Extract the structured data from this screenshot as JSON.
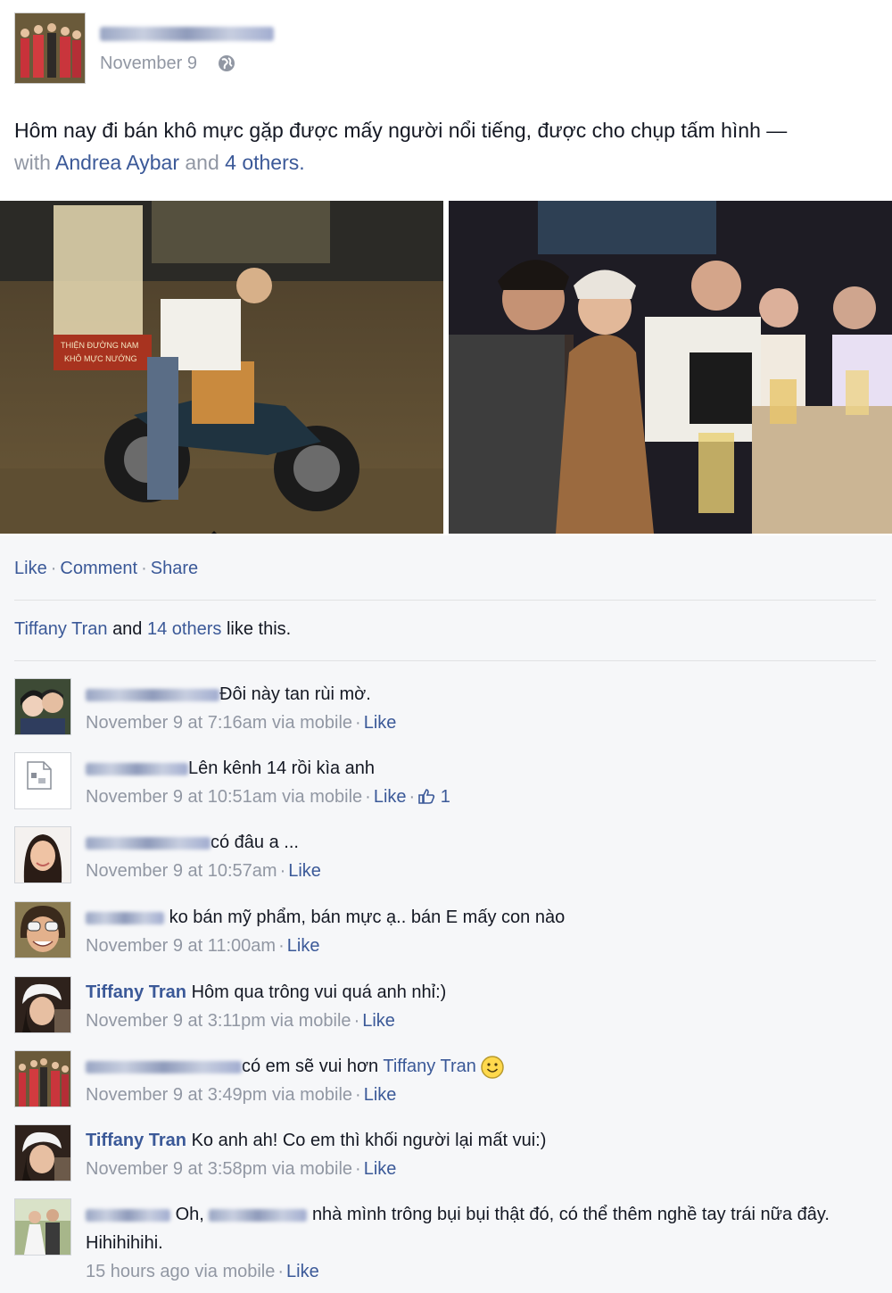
{
  "post": {
    "date": "November 9",
    "text_main": "Hôm nay đi bán khô mực gặp được mấy người nổi tiếng, được cho chụp tấm hình —",
    "with_label": "with",
    "tag_person": "Andrea Aybar",
    "and_label": "and",
    "others_link": "4 others.",
    "photo_sign_line1": "THIỆN ĐƯỜNG NAM",
    "photo_sign_line2": "KHÔ MỰC NƯỚNG"
  },
  "actions": {
    "like": "Like",
    "comment": "Comment",
    "share": "Share"
  },
  "likes": {
    "name": "Tiffany Tran",
    "and": "and",
    "others": "14 others",
    "suffix": "like this."
  },
  "comments": [
    {
      "text": "Đôi này tan rùi mờ.",
      "time": "November 9 at 7:16am via mobile",
      "like": "Like"
    },
    {
      "text": "Lên kênh 14 rồi kìa anh",
      "time": "November 9 at 10:51am via mobile",
      "like": "Like",
      "like_count": "1"
    },
    {
      "text": "có đâu a ...",
      "time": "November 9 at 10:57am",
      "like": "Like"
    },
    {
      "text": "ko bán mỹ phẩm, bán mực ạ.. bán E mấy con nào",
      "time": "November 9 at 11:00am",
      "like": "Like"
    },
    {
      "name": "Tiffany Tran",
      "text": "Hôm qua trông vui quá anh nhỉ:)",
      "time": "November 9 at 3:11pm via mobile",
      "like": "Like"
    },
    {
      "text": "có em sẽ vui hơn",
      "mention": "Tiffany Tran",
      "time": "November 9 at 3:49pm via mobile",
      "like": "Like"
    },
    {
      "name": "Tiffany Tran",
      "text": "Ko anh ah! Co em thì khối người lại mất vui:)",
      "time": "November 9 at 3:58pm via mobile",
      "like": "Like"
    },
    {
      "text_a": "Oh,",
      "text_b": "nhà mình trông bụi bụi thật đó, có thể thêm nghề tay trái nữa đây. Hihihihihi.",
      "time": "15 hours ago via mobile",
      "like": "Like"
    }
  ],
  "colors": {
    "link": "#3b5998",
    "meta": "#9197a3",
    "feedback_bg": "#f6f7f9"
  }
}
